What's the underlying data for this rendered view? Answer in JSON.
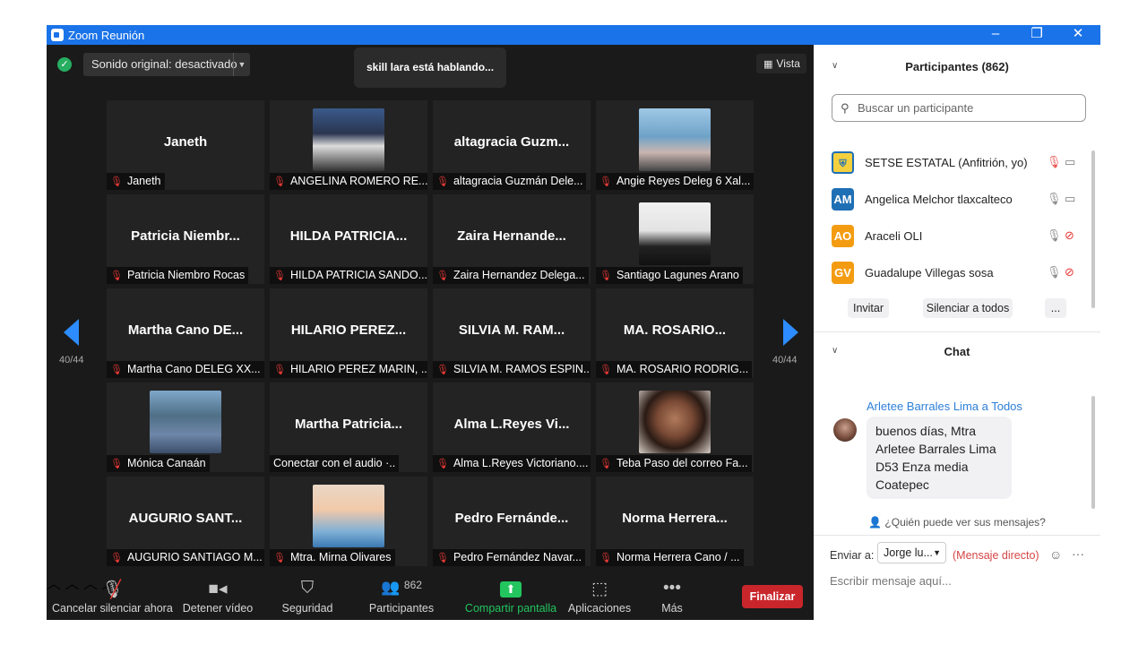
{
  "window": {
    "title": "Zoom Reunión",
    "minimize": "–",
    "restore": "❐",
    "close": "✕"
  },
  "top_bar": {
    "audio_label": "Sonido original: desactivado",
    "speaking": "skill lara está hablando...",
    "view_label": "Vista"
  },
  "pagination": {
    "left": "40/44",
    "right": "40/44"
  },
  "tiles": [
    {
      "big": "Janeth",
      "label": "Janeth",
      "photo": ""
    },
    {
      "big": "",
      "label": "ANGELINA ROMERO RE...",
      "photo": "couple"
    },
    {
      "big": "altagracia  Guzm...",
      "label": "altagracia Guzmán Dele...",
      "photo": ""
    },
    {
      "big": "",
      "label": "Angie Reyes Deleg 6 Xal...",
      "photo": "sea"
    },
    {
      "big": "Patricia  Niembr...",
      "label": "Patricia Niembro Rocas",
      "photo": ""
    },
    {
      "big": "HILDA PATRICIA...",
      "label": "HILDA PATRICIA SANDO...",
      "photo": ""
    },
    {
      "big": "Zaira  Hernande...",
      "label": "Zaira Hernandez Delega...",
      "photo": ""
    },
    {
      "big": "",
      "label": "Santiago Lagunes Arano",
      "photo": "suit"
    },
    {
      "big": "Martha Cano  DE...",
      "label": "Martha Cano DELEG XX...",
      "photo": ""
    },
    {
      "big": "HILARIO  PEREZ...",
      "label": "HILARIO PEREZ MARIN, ...",
      "photo": ""
    },
    {
      "big": "SILVIA  M.  RAM...",
      "label": "SILVIA M. RAMOS ESPIN...",
      "photo": ""
    },
    {
      "big": "MA.  ROSARIO...",
      "label": "MA. ROSARIO  RODRIG...",
      "photo": ""
    },
    {
      "big": "",
      "label": "Mónica Canaán",
      "photo": "lake"
    },
    {
      "big": "Martha  Patricia...",
      "label": "Conectar con el audio ·..",
      "photo": "",
      "nomic": true
    },
    {
      "big": "Alma  L.Reyes  Vi...",
      "label": "Alma L.Reyes Victoriano....",
      "photo": ""
    },
    {
      "big": "",
      "label": "Teba Paso del correo Fa...",
      "photo": "face"
    },
    {
      "big": "AUGURIO  SANT...",
      "label": "AUGURIO SANTIAGO M...",
      "photo": ""
    },
    {
      "big": "",
      "label": "Mtra. Mirna Olivares",
      "photo": "glasses"
    },
    {
      "big": "Pedro  Fernánde...",
      "label": "Pedro Fernández Navar...",
      "photo": ""
    },
    {
      "big": "Norma  Herrera...",
      "label": "Norma Herrera Cano / ...",
      "photo": ""
    }
  ],
  "toolbar": {
    "mute_label": "Cancelar silenciar ahora",
    "video_label": "Detener vídeo",
    "security_label": "Seguridad",
    "participants_label": "Participantes",
    "participants_count": "862",
    "share_label": "Compartir pantalla",
    "apps_label": "Aplicaciones",
    "more_label": "Más",
    "end_label": "Finalizar"
  },
  "participants_panel": {
    "title": "Participantes (862)",
    "search_placeholder": "Buscar un participante",
    "rows": [
      {
        "initials": "",
        "name": "SETSE ESTATAL (Anfitrión, yo)",
        "color": "#f4d03f"
      },
      {
        "initials": "AM",
        "name": "Angelica Melchor tlaxcalteco",
        "color": "#1f6fb5"
      },
      {
        "initials": "AO",
        "name": "Araceli OLI",
        "color": "#f39c12"
      },
      {
        "initials": "GV",
        "name": "Guadalupe Villegas sosa",
        "color": "#f39c12"
      }
    ],
    "invite": "Invitar",
    "mute_all": "Silenciar a todos",
    "more": "..."
  },
  "chat": {
    "title": "Chat",
    "from": "Arletee Barrales Lima a Todos",
    "message_lines": [
      "buenos días, Mtra",
      "Arletee Barrales Lima",
      "D53 Enza media",
      "Coatepec"
    ],
    "who_can_see": "¿Quién puede ver sus mensajes?",
    "send_to_label": "Enviar a:",
    "recipient": "Jorge lu...",
    "direct_label": "(Mensaje directo)",
    "compose_placeholder": "Escribir mensaje aquí..."
  },
  "colors": {
    "accent": "#2d8cff",
    "end": "#c9262c",
    "share": "#22c55e",
    "muted_mic": "#e53935"
  }
}
